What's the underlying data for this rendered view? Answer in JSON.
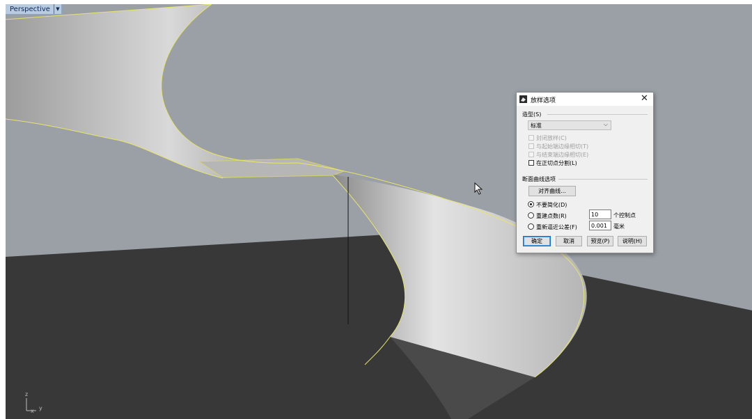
{
  "viewport": {
    "label": "Perspective",
    "axis_labels": {
      "z": "z",
      "x": "x",
      "y": "y"
    },
    "colors": {
      "sky": "#9aa0a6",
      "ground": "#383838",
      "edge": "#e8e46a",
      "surface_light": "#dedede",
      "surface_dark": "#7c7c7c"
    }
  },
  "dialog": {
    "title": "放样选项",
    "style_section": "造型(S)",
    "style_value": "标准",
    "options": [
      {
        "label": "封闭放样(C)",
        "checked": false,
        "enabled": false
      },
      {
        "label": "与起始端边缘相切(T)",
        "checked": false,
        "enabled": false
      },
      {
        "label": "与结束端边缘相切(E)",
        "checked": false,
        "enabled": false
      },
      {
        "label": "在正切点分割(L)",
        "checked": false,
        "enabled": true
      }
    ],
    "cross_section_title": "断面曲线选项",
    "align_button": "对齐曲线...",
    "radios": [
      {
        "label": "不要简化(D)",
        "selected": true
      },
      {
        "label": "重建点数(R)",
        "selected": false,
        "value": "10",
        "unit": "个控制点"
      },
      {
        "label": "重新逼近公差(F)",
        "selected": false,
        "value": "0.001",
        "unit": "毫米"
      }
    ],
    "buttons": {
      "ok": "确定",
      "cancel": "取消",
      "preview": "预览(P)",
      "help": "说明(H)"
    }
  }
}
